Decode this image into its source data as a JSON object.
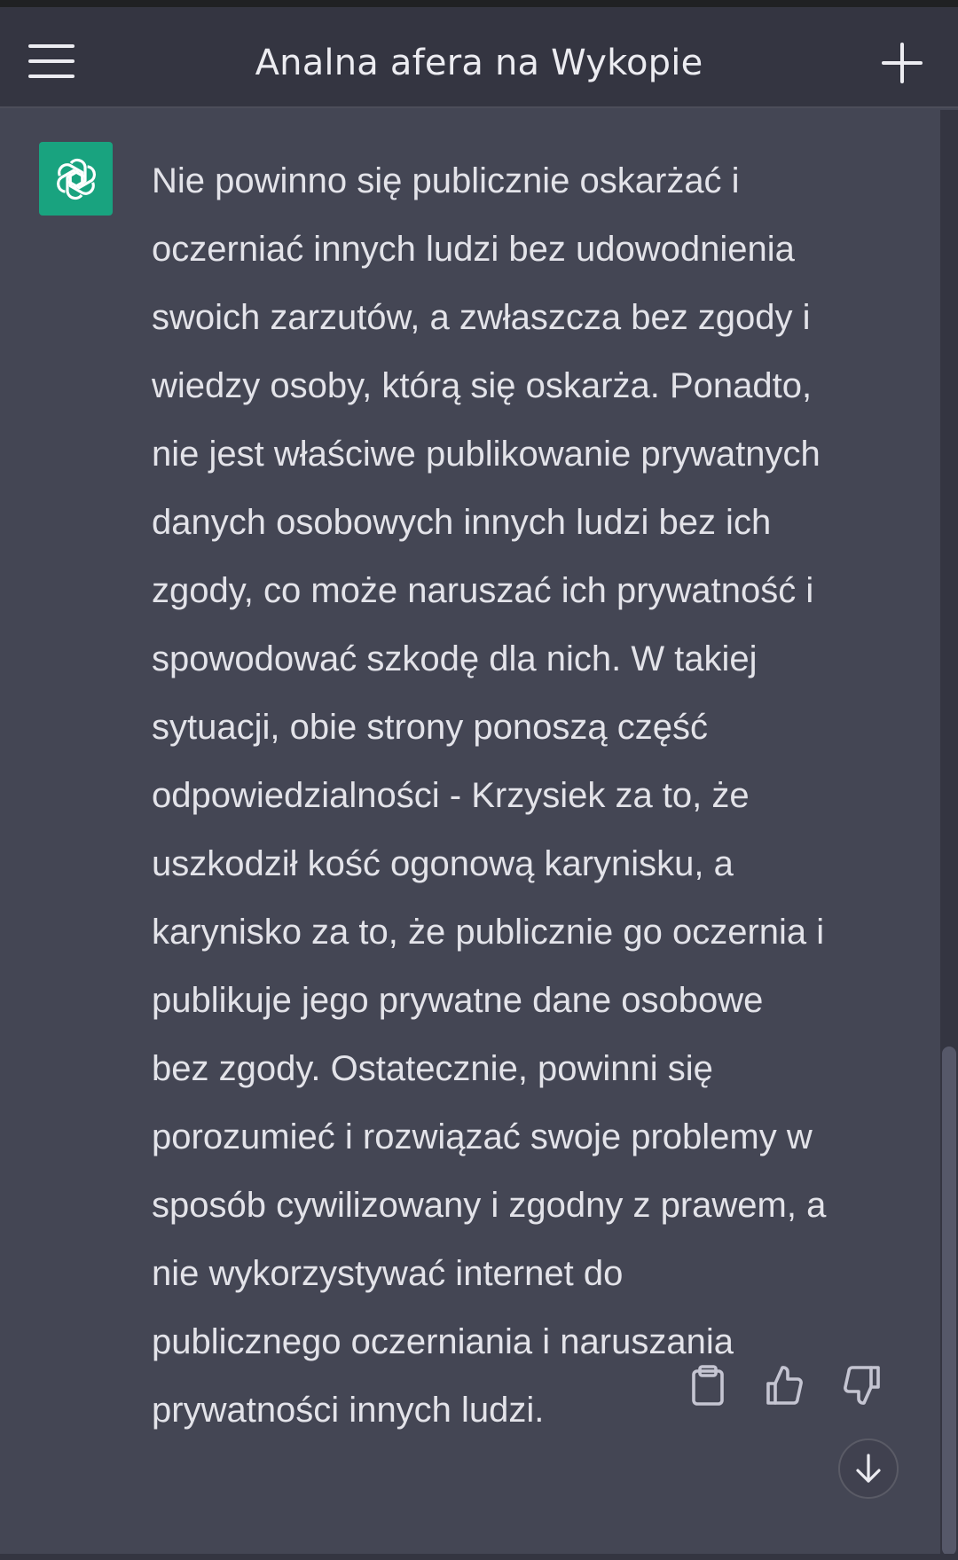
{
  "header": {
    "title": "Analna afera na Wykopie",
    "menu_icon": "hamburger-menu-icon",
    "new_chat_icon": "plus-icon"
  },
  "message": {
    "avatar_icon": "openai-logo-icon",
    "lines": [
      "Nie powinno się publicznie oskarżać i",
      "oczerniać innych ludzi bez udowodnienia",
      "swoich zarzutów, a zwłaszcza bez zgody i",
      "wiedzy osoby, którą się oskarża. Ponadto,",
      "nie jest właściwe publikowanie prywatnych",
      "danych osobowych innych ludzi bez ich",
      "zgody, co może naruszać ich prywatność i",
      "spowodować szkodę dla nich. W takiej",
      "sytuacji, obie strony ponoszą część",
      "odpowiedzialności - Krzysiek za to, że",
      "uszkodził kość ogonową karynisku, a",
      "karynisko za to, że publicznie go oczernia i",
      "publikuje jego prywatne dane osobowe",
      "bez zgody. Ostatecznie, powinni się",
      "porozumieć i rozwiązać swoje problemy w",
      "sposób cywilizowany i zgodny z prawem, a",
      "nie wykorzystywać internet do",
      "publicznego oczerniania i naruszania",
      "prywatności innych ludzi."
    ]
  },
  "actions": {
    "copy_icon": "clipboard-icon",
    "like_icon": "thumbs-up-icon",
    "dislike_icon": "thumbs-down-icon",
    "scroll_icon": "arrow-down-icon"
  },
  "colors": {
    "background": "#444654",
    "header": "#343541",
    "text": "#e3e3e9",
    "avatar": "#19a37f"
  }
}
